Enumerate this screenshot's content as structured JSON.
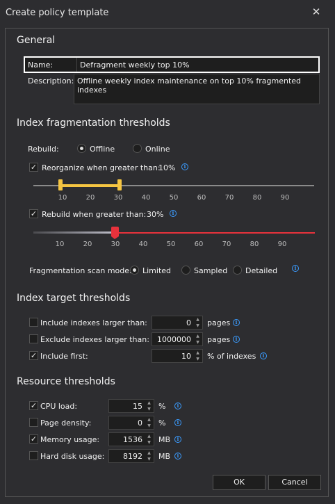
{
  "window": {
    "title": "Create policy template"
  },
  "general": {
    "heading": "General",
    "name_label": "Name:",
    "name_value": "Defragment weekly top 10%",
    "description_label": "Description:",
    "description_value": "Offline weekly index maintenance on top 10% fragmented indexes"
  },
  "fragmentation": {
    "heading": "Index fragmentation thresholds",
    "rebuild_label": "Rebuild:",
    "rebuild_options": [
      "Offline",
      "Online"
    ],
    "rebuild_selected": "Offline",
    "reorganize": {
      "checked": true,
      "label": "Reorganize when greater than:",
      "value_text": "10%",
      "range_low": 10,
      "range_high": 30
    },
    "rebuild_threshold": {
      "checked": true,
      "label": "Rebuild when greater than:",
      "value_text": "30%",
      "value": 30
    },
    "ticks": [
      "10",
      "20",
      "30",
      "40",
      "50",
      "60",
      "70",
      "80",
      "90"
    ],
    "scan_mode_label": "Fragmentation scan mode:",
    "scan_modes": [
      "Limited",
      "Sampled",
      "Detailed"
    ],
    "scan_mode_selected": "Limited",
    "accent_color": "#f5c542",
    "rebuild_color": "#e8323c"
  },
  "target": {
    "heading": "Index target thresholds",
    "rows": [
      {
        "checked": false,
        "label": "Include indexes larger than:",
        "value": "0",
        "unit": "pages"
      },
      {
        "checked": false,
        "label": "Exclude indexes larger than:",
        "value": "1000000",
        "unit": "pages"
      },
      {
        "checked": true,
        "label": "Include first:",
        "value": "10",
        "unit": "% of indexes"
      }
    ]
  },
  "resource": {
    "heading": "Resource thresholds",
    "rows": [
      {
        "checked": true,
        "label": "CPU load:",
        "value": "15",
        "unit": "%"
      },
      {
        "checked": false,
        "label": "Page density:",
        "value": "0",
        "unit": "%"
      },
      {
        "checked": true,
        "label": "Memory usage:",
        "value": "1536",
        "unit": "MB"
      },
      {
        "checked": false,
        "label": "Hard disk usage:",
        "value": "8192",
        "unit": "MB"
      }
    ]
  },
  "buttons": {
    "ok": "OK",
    "cancel": "Cancel"
  },
  "icons": {
    "info": "info-icon",
    "close": "close-icon",
    "check": "✓"
  }
}
